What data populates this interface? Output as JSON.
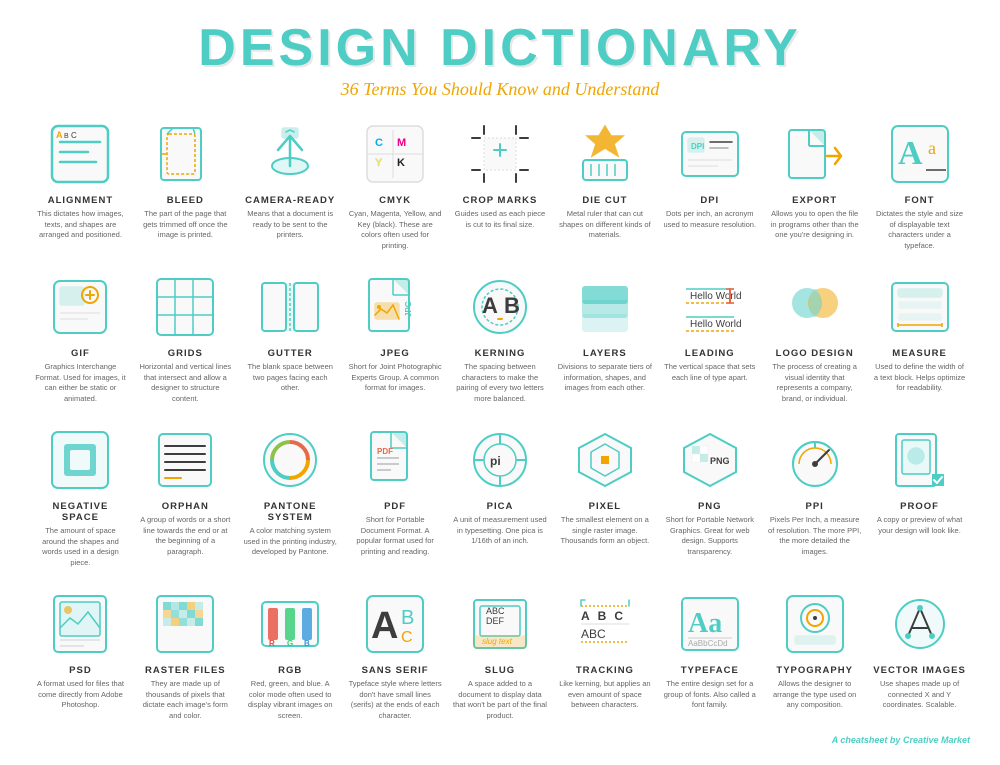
{
  "header": {
    "title": "DESIGN DICTIONARY",
    "subtitle": "36 Terms You Should Know and Understand"
  },
  "terms": [
    {
      "name": "ALIGNMENT",
      "desc": "This dictates how images, texts, and shapes are arranged and positioned.",
      "icon": "alignment"
    },
    {
      "name": "BLEED",
      "desc": "The part of the page that gets trimmed off once the image is printed.",
      "icon": "bleed"
    },
    {
      "name": "CAMERA-READY",
      "desc": "Means that a document is ready to be sent to the printers.",
      "icon": "camera-ready"
    },
    {
      "name": "CMYK",
      "desc": "Cyan, Magenta, Yellow, and Key (black). These are colors often used for printing.",
      "icon": "cmyk"
    },
    {
      "name": "CROP MARKS",
      "desc": "Guides used as each piece is cut to its final size.",
      "icon": "crop-marks"
    },
    {
      "name": "DIE CUT",
      "desc": "Metal ruler that can cut shapes on different kinds of materials.",
      "icon": "die-cut"
    },
    {
      "name": "DPI",
      "desc": "Dots per inch, an acronym used to measure resolution.",
      "icon": "dpi"
    },
    {
      "name": "EXPORT",
      "desc": "Allows you to open the file in programs other than the one you're designing in.",
      "icon": "export"
    },
    {
      "name": "FONT",
      "desc": "Dictates the style and size of displayable text characters under a typeface.",
      "icon": "font"
    },
    {
      "name": "GIF",
      "desc": "Graphics Interchange Format. Used for images, it can either be static or animated.",
      "icon": "gif"
    },
    {
      "name": "GRIDS",
      "desc": "Horizontal and vertical lines that intersect and allow a designer to structure content.",
      "icon": "grids"
    },
    {
      "name": "GUTTER",
      "desc": "The blank space between two pages facing each other.",
      "icon": "gutter"
    },
    {
      "name": "JPEG",
      "desc": "Short for Joint Photographic Experts Group. A common format for images.",
      "icon": "jpeg"
    },
    {
      "name": "KERNING",
      "desc": "The spacing between characters to make the pairing of every two letters more balanced.",
      "icon": "kerning"
    },
    {
      "name": "LAYERS",
      "desc": "Divisions to separate tiers of information, shapes, and images from each other.",
      "icon": "layers"
    },
    {
      "name": "LEADING",
      "desc": "The vertical space that sets each line of type apart.",
      "icon": "leading"
    },
    {
      "name": "LOGO DESIGN",
      "desc": "The process of creating a visual identity that represents a company, brand, or individual.",
      "icon": "logo-design"
    },
    {
      "name": "MEASURE",
      "desc": "Used to define the width of a text block. Helps optimize for readability.",
      "icon": "measure"
    },
    {
      "name": "NEGATIVE SPACE",
      "desc": "The amount of space around the shapes and words used in a design piece.",
      "icon": "negative-space"
    },
    {
      "name": "ORPHAN",
      "desc": "A group of words or a short line towards the end or at the beginning of a paragraph.",
      "icon": "orphan"
    },
    {
      "name": "PANTONE SYSTEM",
      "desc": "A color matching system used in the printing industry, developed by Pantone.",
      "icon": "pantone-system"
    },
    {
      "name": "PDF",
      "desc": "Short for Portable Document Format. A popular format used for printing and reading.",
      "icon": "pdf"
    },
    {
      "name": "PICA",
      "desc": "A unit of measurement used in typesetting. One pica is 1/16th of an inch.",
      "icon": "pica"
    },
    {
      "name": "PIXEL",
      "desc": "The smallest element on a single raster image. Thousands form an object.",
      "icon": "pixel"
    },
    {
      "name": "PNG",
      "desc": "Short for Portable Network Graphics. Great for web design. Supports transparency.",
      "icon": "png"
    },
    {
      "name": "PPI",
      "desc": "Pixels Per Inch, a measure of resolution. The more PPI, the more detailed the images.",
      "icon": "ppi"
    },
    {
      "name": "PROOF",
      "desc": "A copy or preview of what your design will look like.",
      "icon": "proof"
    },
    {
      "name": "PSD",
      "desc": "A format used for files that come directly from Adobe Photoshop.",
      "icon": "psd"
    },
    {
      "name": "RASTER FILES",
      "desc": "They are made up of thousands of pixels that dictate each image's form and color.",
      "icon": "raster-files"
    },
    {
      "name": "RGB",
      "desc": "Red, green, and blue. A color mode often used to display vibrant images on screen.",
      "icon": "rgb"
    },
    {
      "name": "SANS SERIF",
      "desc": "Typeface style where letters don't have small lines (serifs) at the ends of each character.",
      "icon": "sans-serif"
    },
    {
      "name": "SLUG",
      "desc": "A space added to a document to display data that won't be part of the final product.",
      "icon": "slug"
    },
    {
      "name": "TRACKING",
      "desc": "Like kerning, but applies an even amount of space between characters.",
      "icon": "tracking"
    },
    {
      "name": "TYPEFACE",
      "desc": "The entire design set for a group of fonts. Also called a font family.",
      "icon": "typeface"
    },
    {
      "name": "TYPOGRAPHY",
      "desc": "Allows the designer to arrange the type used on any composition.",
      "icon": "typography"
    },
    {
      "name": "VECTOR IMAGES",
      "desc": "Use shapes made up of connected X and Y coordinates. Scalable.",
      "icon": "vector-images"
    }
  ],
  "footer": {
    "text": "A cheatsheet by",
    "brand": "Creative Market"
  },
  "colors": {
    "teal": "#4ecdc4",
    "orange": "#f0a500",
    "dark": "#3a3a3a",
    "gray": "#888888",
    "light_blue": "#5bc8d6",
    "coral": "#f47c5a"
  }
}
